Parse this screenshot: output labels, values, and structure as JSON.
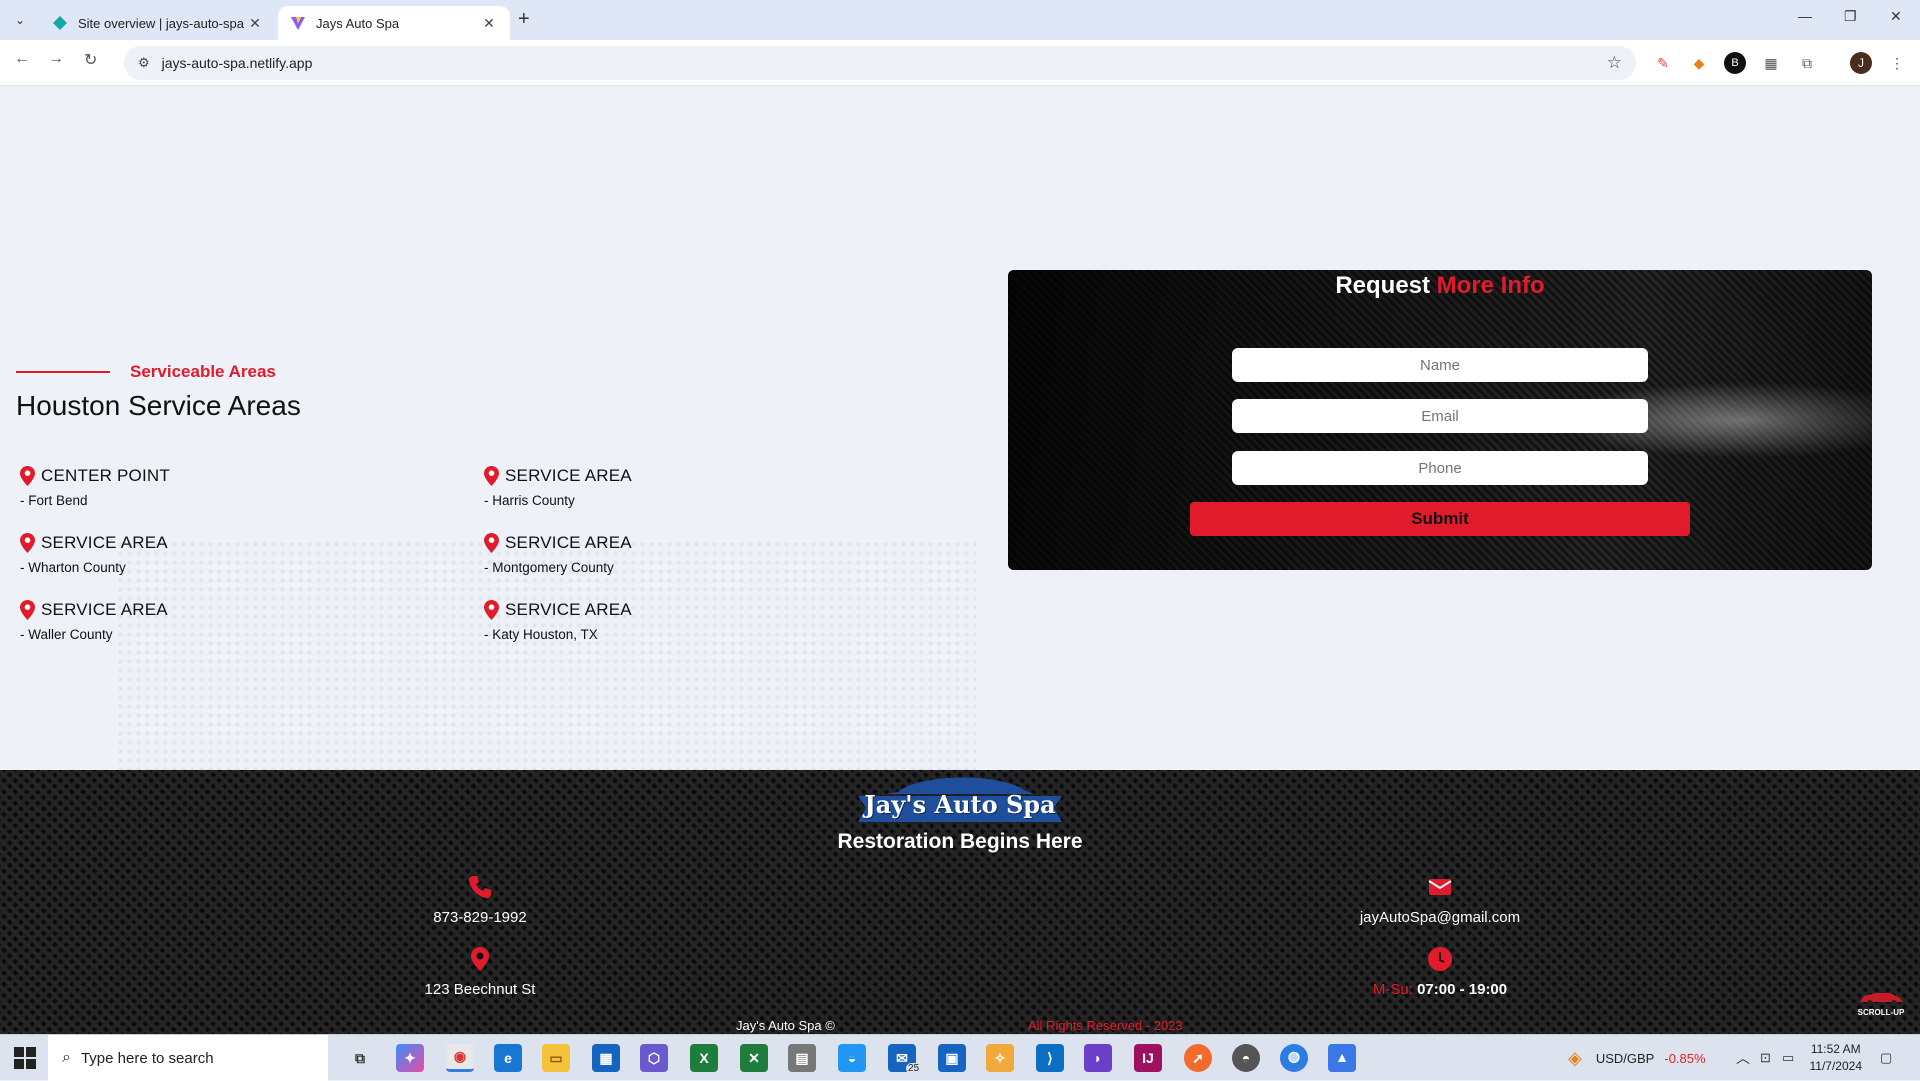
{
  "browser": {
    "tabs": [
      {
        "title": "Site overview | jays-auto-spa | N",
        "active": false
      },
      {
        "title": "Jays Auto Spa",
        "active": true
      }
    ],
    "url": "jays-auto-spa.netlify.app",
    "profile_initial": "J"
  },
  "service_areas": {
    "eyebrow": "Serviceable Areas",
    "heading": "Houston Service Areas",
    "items": [
      {
        "title": "CENTER POINT",
        "sub": "- Fort Bend"
      },
      {
        "title": "SERVICE AREA",
        "sub": "- Harris County"
      },
      {
        "title": "SERVICE AREA",
        "sub": "- Wharton County"
      },
      {
        "title": "SERVICE AREA",
        "sub": "- Montgomery County"
      },
      {
        "title": "SERVICE AREA",
        "sub": "- Waller County"
      },
      {
        "title": "SERVICE AREA",
        "sub": "- Katy Houston, TX"
      }
    ]
  },
  "form": {
    "title_white": "Request",
    "title_red": "More Info",
    "name_placeholder": "Name",
    "email_placeholder": "Email",
    "phone_placeholder": "Phone",
    "submit_label": "Submit"
  },
  "footer": {
    "logo_text": "Jay's Auto Spa",
    "tagline": "Restoration Begins Here",
    "phone": "873-829-1992",
    "email": "jayAutoSpa@gmail.com",
    "address": "123 Beechnut St",
    "hours_days": "M-Su:",
    "hours_time": "07:00 - 19:00",
    "copyright": "Jay's Auto Spa ©",
    "rights": "All Rights Reserved - 2023",
    "scroll_up": "SCROLL-UP"
  },
  "taskbar": {
    "search_placeholder": "Type here to search",
    "ticker_pair": "USD/GBP",
    "ticker_change": "-0.85%",
    "time": "11:52 AM",
    "date": "11/7/2024",
    "mail_badge": "25"
  },
  "colors": {
    "accent": "#e11b2c",
    "logo_blue": "#1f4f9c"
  }
}
